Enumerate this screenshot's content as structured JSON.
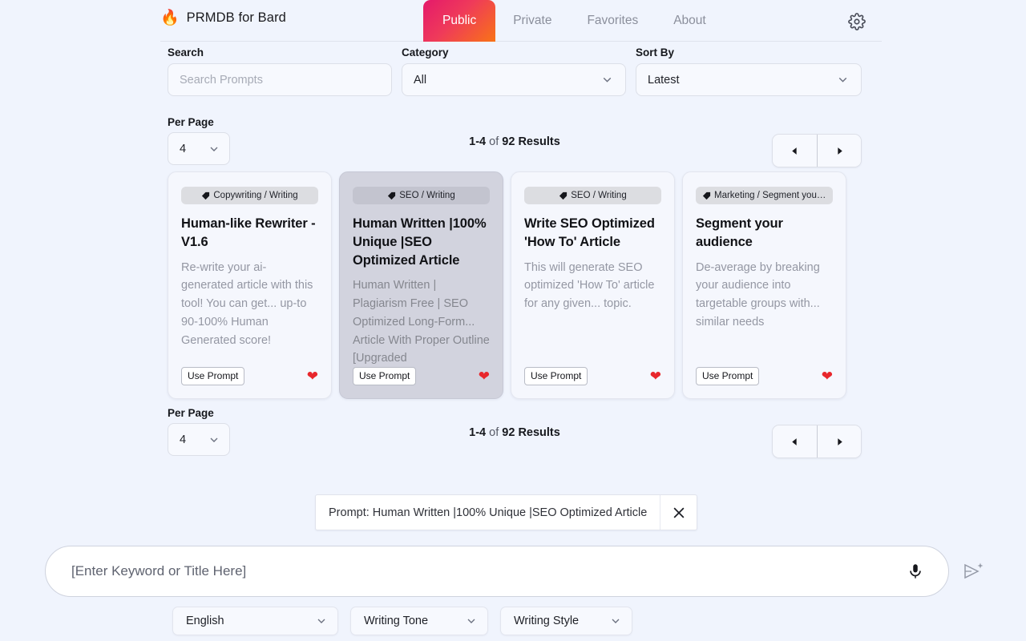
{
  "header": {
    "logo_icon": "flame-icon",
    "title": "PRMDB for Bard",
    "tabs": [
      {
        "label": "Public",
        "active": true
      },
      {
        "label": "Private",
        "active": false
      },
      {
        "label": "Favorites",
        "active": false
      },
      {
        "label": "About",
        "active": false
      }
    ],
    "settings_icon": "gear-icon",
    "active_tab_gradient_from": "#e4196b",
    "active_tab_gradient_to": "#f97316"
  },
  "filters": {
    "search": {
      "label": "Search",
      "value": "",
      "placeholder": "Search Prompts"
    },
    "category": {
      "label": "Category",
      "value": "All"
    },
    "sort_by": {
      "label": "Sort By",
      "value": "Latest"
    }
  },
  "pagination": {
    "per_page_label": "Per Page",
    "per_page_value": "4",
    "range": "1-4",
    "of": "of",
    "total": "92 Results",
    "prev_icon": "triangle-left-icon",
    "next_icon": "triangle-right-icon"
  },
  "cards": [
    {
      "tag": "Copywriting / Writing",
      "title": "Human-like Rewriter - V1.6",
      "description": "Re-write your ai-generated article with this tool! You can get... up-to 90-100% Human Generated score!",
      "use_prompt_label": "Use Prompt",
      "favorite_icon": "heart-icon",
      "selected": false
    },
    {
      "tag": "SEO / Writing",
      "title": "Human Written |100% Unique |SEO Optimized Article",
      "description": "Human Written | Plagiarism Free | SEO Optimized Long-Form... Article With Proper Outline [Upgraded",
      "use_prompt_label": "Use Prompt",
      "favorite_icon": "heart-icon",
      "selected": true
    },
    {
      "tag": "SEO / Writing",
      "title": "Write SEO Optimized 'How To' Article",
      "description": "This will generate SEO optimized 'How To' article for any given... topic.",
      "use_prompt_label": "Use Prompt",
      "favorite_icon": "heart-icon",
      "selected": false
    },
    {
      "tag": "Marketing / Segment your a...",
      "title": "Segment your audience",
      "description": "De-average by breaking your audience into targetable groups with... similar needs",
      "use_prompt_label": "Use Prompt",
      "favorite_icon": "heart-icon",
      "selected": false
    }
  ],
  "prompt_chip": {
    "text": "Prompt: Human Written |100% Unique |SEO Optimized Article",
    "close_icon": "close-icon"
  },
  "composer": {
    "input_value": "",
    "input_placeholder": "[Enter Keyword or Title Here]",
    "mic_icon": "microphone-icon",
    "send_icon": "send-sparkle-icon"
  },
  "bottom_selects": {
    "language": "English",
    "tone": "Writing Tone",
    "style": "Writing Style"
  },
  "colors": {
    "background": "#f0f4fd",
    "accent_pink": "#e4196b",
    "accent_orange": "#f97316",
    "heart_red": "#e8272c",
    "selected_card": "#d2d3de"
  }
}
